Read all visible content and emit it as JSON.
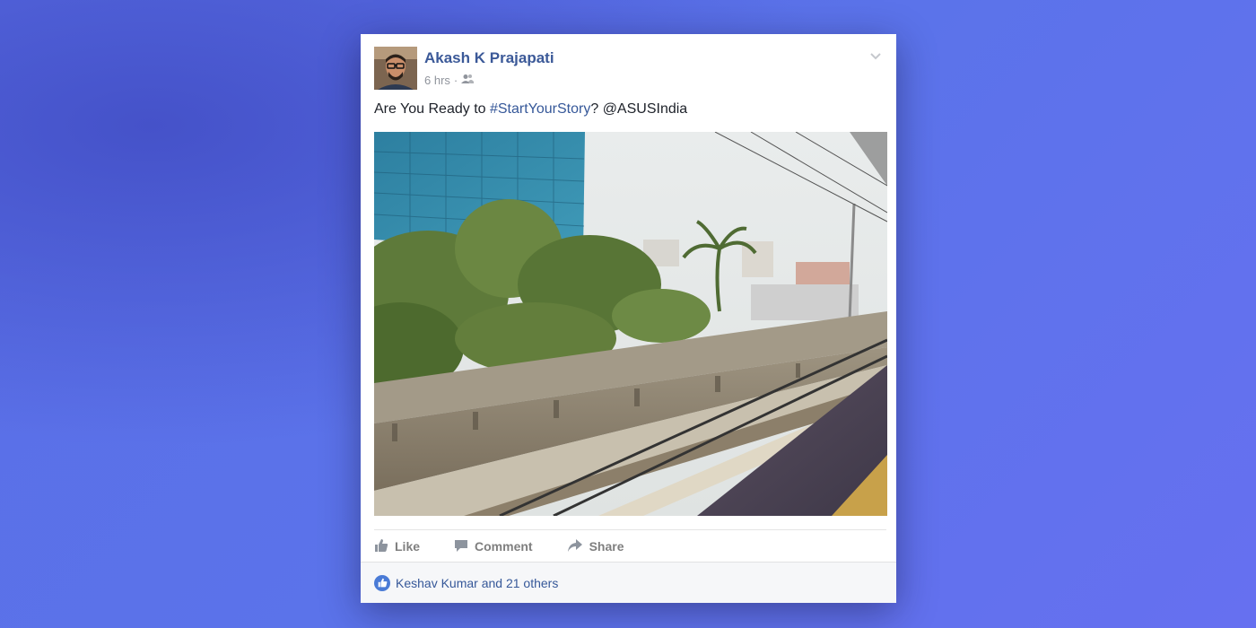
{
  "post": {
    "author": "Akash K Prajapati",
    "time": "6 hrs",
    "separator": "·",
    "audience_icon": "friends-icon",
    "message_prefix": "Are You Ready to ",
    "hashtag": "#StartYourStory",
    "message_mid": "? ",
    "mention": "@ASUSIndia",
    "menu_icon": "chevron-down-icon"
  },
  "actions": {
    "like_label": "Like",
    "comment_label": "Comment",
    "share_label": "Share"
  },
  "reactions": {
    "text": "Keshav Kumar and 21 others",
    "icon": "like-icon"
  },
  "colors": {
    "link": "#365899",
    "author": "#3b5998",
    "action_gray": "#7f7f7f",
    "like_badge": "#4a7bd6"
  }
}
